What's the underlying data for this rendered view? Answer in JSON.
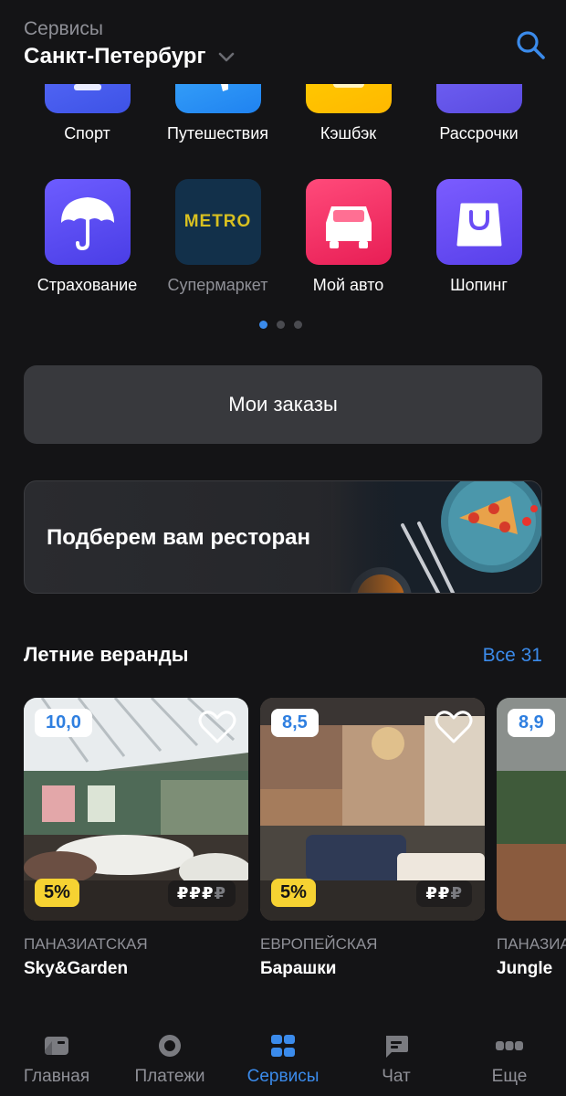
{
  "header": {
    "subtitle": "Сервисы",
    "city": "Санкт-Петербург"
  },
  "services": [
    {
      "label": "Спорт",
      "icon": "trophy-icon"
    },
    {
      "label": "Путешествия",
      "icon": "airplane-icon"
    },
    {
      "label": "Кэшбэк",
      "icon": "cashback-icon"
    },
    {
      "label": "Рассрочки",
      "icon": "installment-icon"
    },
    {
      "label": "Страхование",
      "icon": "umbrella-icon"
    },
    {
      "label": "Супермаркет",
      "icon": "metro-logo",
      "logo_text": "METRO"
    },
    {
      "label": "Мой авто",
      "icon": "car-icon"
    },
    {
      "label": "Шопинг",
      "icon": "shopping-bag-icon"
    }
  ],
  "orders": {
    "label": "Мои заказы"
  },
  "banner": {
    "text": "Подберем вам ресторан"
  },
  "section": {
    "title": "Летние веранды",
    "link": "Все 31"
  },
  "restaurants": [
    {
      "rating": "10,0",
      "discount": "5%",
      "price_on": "₽₽₽",
      "price_off": "₽",
      "cuisine": "ПАНАЗИАТСКАЯ",
      "name": "Sky&Garden"
    },
    {
      "rating": "8,5",
      "discount": "5%",
      "price_on": "₽₽",
      "price_off": "₽",
      "cuisine": "ЕВРОПЕЙСКАЯ",
      "name": "Барашки"
    },
    {
      "rating": "8,9",
      "cuisine": "ПАНАЗИА",
      "name": "Jungle"
    }
  ],
  "nav": [
    {
      "label": "Главная",
      "icon": "card-icon"
    },
    {
      "label": "Платежи",
      "icon": "circle-icon"
    },
    {
      "label": "Сервисы",
      "icon": "grid-icon",
      "active": true
    },
    {
      "label": "Чат",
      "icon": "chat-icon"
    },
    {
      "label": "Еще",
      "icon": "more-icon"
    }
  ],
  "colors": {
    "accent": "#3b8beb",
    "background": "#141416",
    "surface": "#38393d",
    "discount": "#f6d232"
  }
}
